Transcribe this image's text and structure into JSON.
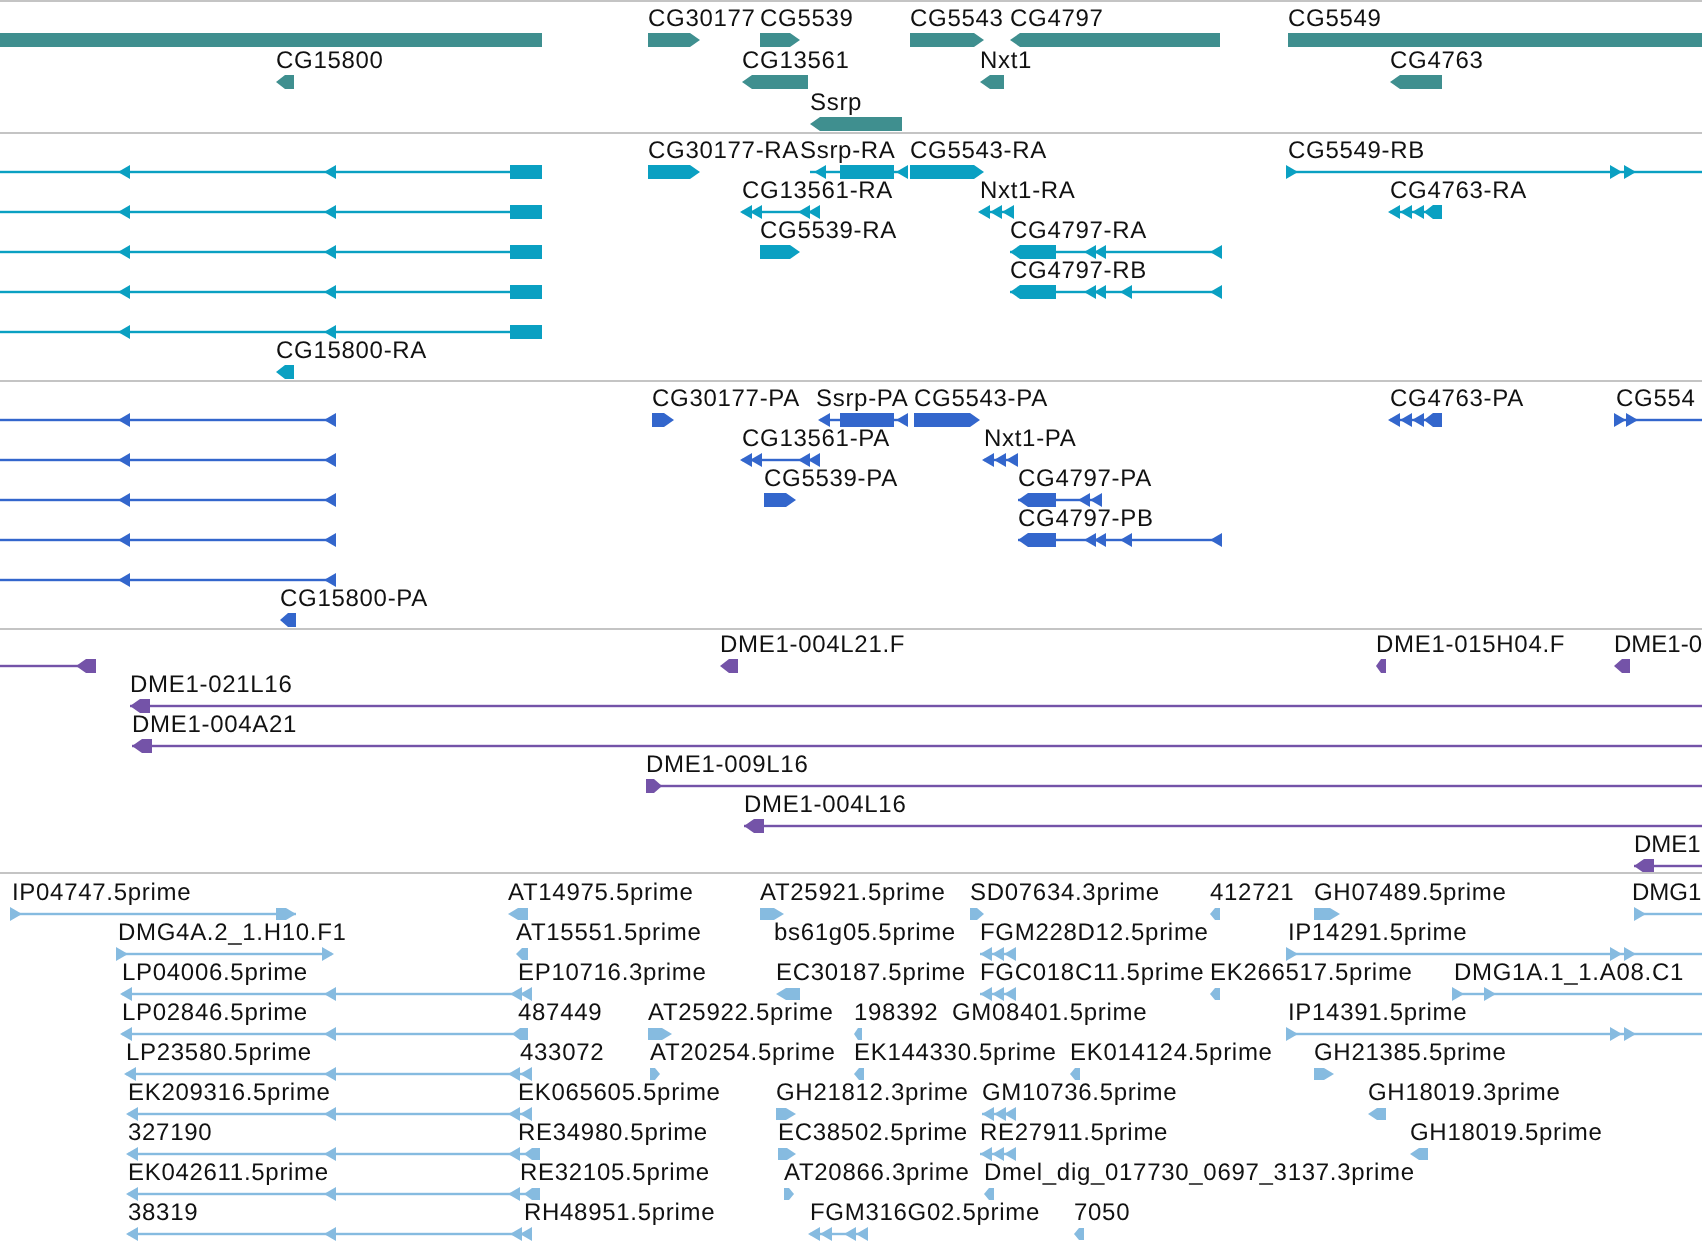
{
  "tracks": [
    {
      "kind": "gene",
      "features": [
        {
          "clipped": true
        },
        {
          "label": "CG30177",
          "reverse_strand": false
        },
        {
          "label": "CG5539",
          "reverse_strand": false
        },
        {
          "label": "CG5543",
          "reverse_strand": false
        },
        {
          "label": "CG4797",
          "reverse_strand": true
        },
        {
          "label": "CG5549",
          "clipped": true
        },
        {
          "label": "CG15800",
          "reverse_strand": true
        },
        {
          "label": "CG13561",
          "reverse_strand": true
        },
        {
          "label": "Nxt1",
          "reverse_strand": true
        },
        {
          "label": "CG4763",
          "reverse_strand": true
        },
        {
          "label": "Ssrp",
          "reverse_strand": true
        }
      ]
    },
    {
      "kind": "transcript",
      "features": [
        {
          "reverse_strand": true
        },
        {
          "label": "CG30177-RA",
          "reverse_strand": false
        },
        {
          "label": "Ssrp-RA",
          "reverse_strand": true
        },
        {
          "label": "CG5543-RA",
          "reverse_strand": false
        },
        {
          "label": "CG5549-RB",
          "reverse_strand": false
        },
        {
          "reverse_strand": true
        },
        {
          "label": "CG13561-RA",
          "reverse_strand": true
        },
        {
          "label": "Nxt1-RA",
          "reverse_strand": true
        },
        {
          "label": "CG4763-RA",
          "reverse_strand": true
        },
        {
          "reverse_strand": true
        },
        {
          "label": "CG5539-RA",
          "reverse_strand": false
        },
        {
          "label": "CG4797-RA",
          "reverse_strand": true
        },
        {
          "reverse_strand": true
        },
        {
          "label": "CG4797-RB",
          "reverse_strand": true
        },
        {
          "reverse_strand": true
        },
        {
          "label": "CG15800-RA",
          "reverse_strand": true
        }
      ]
    },
    {
      "kind": "protein",
      "features": [
        {
          "reverse_strand": true
        },
        {
          "label": "CG30177-PA",
          "reverse_strand": false
        },
        {
          "label": "Ssrp-PA",
          "reverse_strand": true
        },
        {
          "label": "CG5543-PA",
          "reverse_strand": false
        },
        {
          "label": "CG4763-PA",
          "reverse_strand": true
        },
        {
          "label": "CG554",
          "reverse_strand": false
        },
        {
          "reverse_strand": true
        },
        {
          "label": "CG13561-PA",
          "reverse_strand": true
        },
        {
          "label": "Nxt1-PA",
          "reverse_strand": true
        },
        {
          "reverse_strand": true
        },
        {
          "label": "CG5539-PA",
          "reverse_strand": false
        },
        {
          "label": "CG4797-PA",
          "reverse_strand": true
        },
        {
          "reverse_strand": true
        },
        {
          "label": "CG4797-PB",
          "reverse_strand": true
        },
        {
          "reverse_strand": true
        },
        {
          "label": "CG15800-PA",
          "reverse_strand": true
        }
      ]
    },
    {
      "kind": "clone",
      "features": [
        {
          "reverse_strand": true
        },
        {
          "label": "DME1-004L21.F",
          "reverse_strand": true
        },
        {
          "label": "DME1-015H04.F",
          "reverse_strand": true
        },
        {
          "label": "DME1-0",
          "reverse_strand": true
        },
        {
          "label": "DME1-021L16",
          "reverse_strand": true
        },
        {
          "label": "DME1-004A21",
          "reverse_strand": true
        },
        {
          "label": "DME1-009L16",
          "reverse_strand": false
        },
        {
          "label": "DME1-004L16",
          "reverse_strand": true
        },
        {
          "label": "DME1",
          "reverse_strand": true
        }
      ]
    },
    {
      "kind": "est",
      "features": [
        {
          "label": "IP04747.5prime",
          "reverse_strand": false
        },
        {
          "label": "AT14975.5prime",
          "reverse_strand": true
        },
        {
          "label": "AT25921.5prime",
          "reverse_strand": false
        },
        {
          "label": "SD07634.3prime",
          "reverse_strand": false
        },
        {
          "label": "412721",
          "reverse_strand": true
        },
        {
          "label": "GH07489.5prime",
          "reverse_strand": false
        },
        {
          "label": "DMG1",
          "reverse_strand": false
        },
        {
          "label": "DMG4A.2_1.H10.F1",
          "reverse_strand": false
        },
        {
          "label": "AT15551.5prime",
          "reverse_strand": true
        },
        {
          "label": "bs61g05.5prime"
        },
        {
          "label": "FGM228D12.5prime",
          "reverse_strand": true
        },
        {
          "label": "IP14291.5prime",
          "reverse_strand": false
        },
        {
          "label": "LP04006.5prime",
          "reverse_strand": true
        },
        {
          "label": "EP10716.3prime"
        },
        {
          "label": "EC30187.5prime",
          "reverse_strand": true
        },
        {
          "label": "FGC018C11.5prime",
          "reverse_strand": true
        },
        {
          "label": "EK266517.5prime",
          "reverse_strand": true
        },
        {
          "label": "DMG1A.1_1.A08.C1",
          "reverse_strand": false
        },
        {
          "label": "LP02846.5prime",
          "reverse_strand": true
        },
        {
          "label": "487449"
        },
        {
          "label": "AT25922.5prime",
          "reverse_strand": false
        },
        {
          "label": "198392",
          "reverse_strand": true
        },
        {
          "label": "GM08401.5prime"
        },
        {
          "label": "IP14391.5prime",
          "reverse_strand": false
        },
        {
          "label": "LP23580.5prime",
          "reverse_strand": true
        },
        {
          "label": "433072"
        },
        {
          "label": "AT20254.5prime",
          "reverse_strand": false
        },
        {
          "label": "EK144330.5prime",
          "reverse_strand": true
        },
        {
          "label": "EK014124.5prime",
          "reverse_strand": true
        },
        {
          "label": "GH21385.5prime",
          "reverse_strand": false
        },
        {
          "label": "EK209316.5prime",
          "reverse_strand": true
        },
        {
          "label": "EK065605.5prime"
        },
        {
          "label": "GH21812.3prime",
          "reverse_strand": false
        },
        {
          "label": "GM10736.5prime",
          "reverse_strand": true
        },
        {
          "label": "GH18019.3prime",
          "reverse_strand": true
        },
        {
          "label": "327190",
          "reverse_strand": true
        },
        {
          "label": "RE34980.5prime"
        },
        {
          "label": "EC38502.5prime",
          "reverse_strand": false
        },
        {
          "label": "RE27911.5prime",
          "reverse_strand": true
        },
        {
          "label": "GH18019.5prime",
          "reverse_strand": true
        },
        {
          "label": "EK042611.5prime",
          "reverse_strand": true
        },
        {
          "label": "RE32105.5prime"
        },
        {
          "label": "AT20866.3prime",
          "reverse_strand": false
        },
        {
          "label": "Dmel_dig_017730_0697_3137.3prime",
          "reverse_strand": true
        },
        {
          "label": "38319",
          "reverse_strand": true
        },
        {
          "label": "RH48951.5prime"
        },
        {
          "label": "FGM316G02.5prime",
          "reverse_strand": true
        },
        {
          "label": "7050",
          "reverse_strand": true
        }
      ]
    }
  ]
}
